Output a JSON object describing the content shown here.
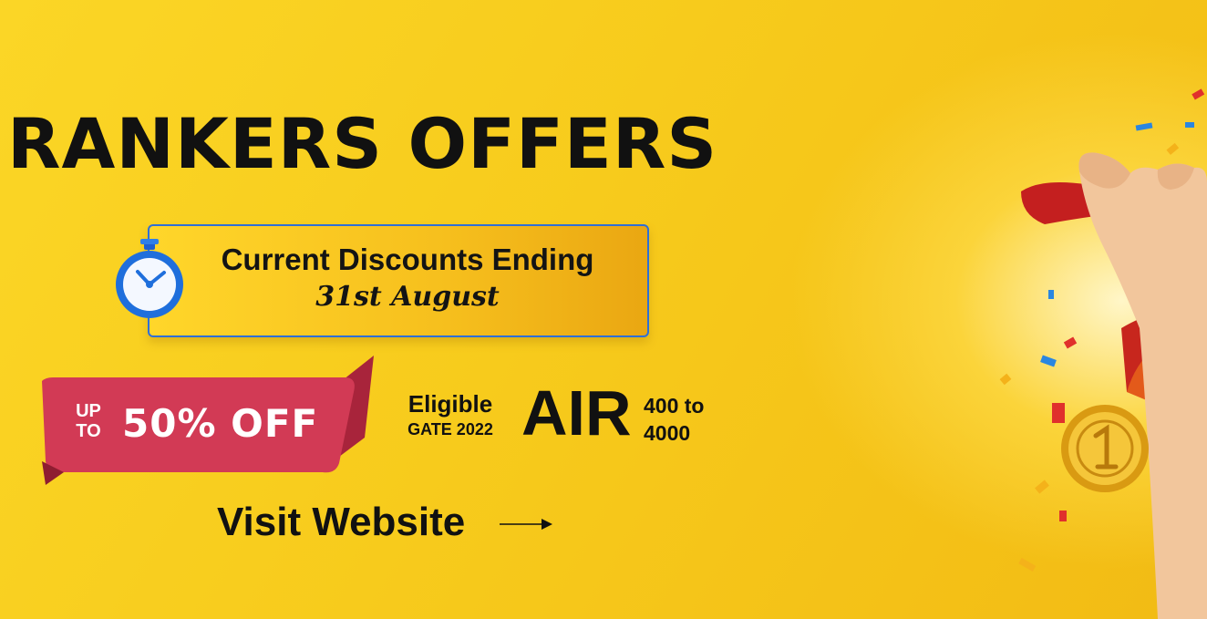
{
  "banner": {
    "headline": "RANKERS OFFERS",
    "discount": {
      "title": "Current Discounts Ending",
      "date": "31st August"
    },
    "offer": {
      "up_to_line1": "UP",
      "up_to_line2": "TO",
      "amount": "50% OFF"
    },
    "eligibility": {
      "line1": "Eligible",
      "line2": "GATE 2022",
      "air_label": "AIR",
      "range_line1": "400 to",
      "range_line2": "4000"
    },
    "cta": {
      "label": "Visit Website"
    }
  },
  "icons": {
    "stopwatch": "stopwatch-icon",
    "arrow": "arrow-right-icon",
    "medal": "medal-hand-illustration"
  },
  "colors": {
    "background": "#f7cb1c",
    "ribbon": "#c8324a",
    "box_border": "#2f6fd6",
    "text": "#111111"
  }
}
